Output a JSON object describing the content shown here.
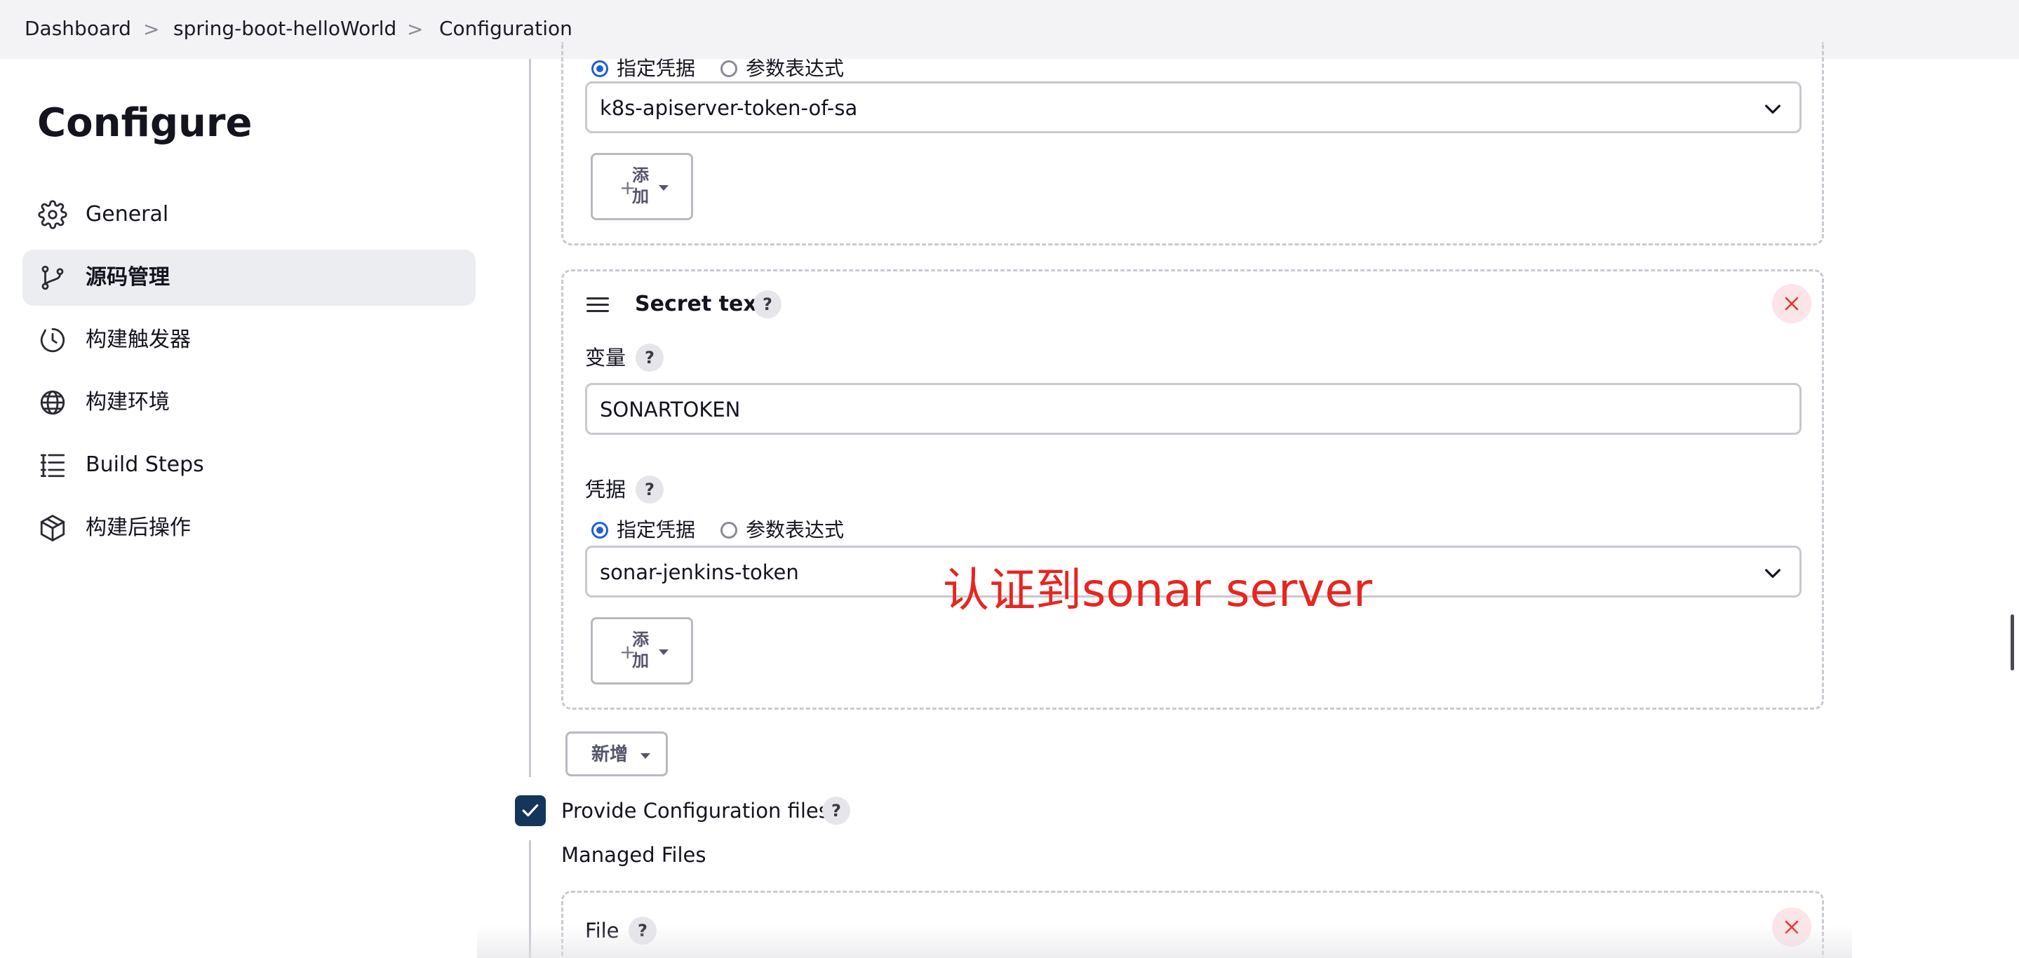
{
  "breadcrumb": {
    "items": [
      "Dashboard",
      "spring-boot-helloWorld",
      "Configuration"
    ],
    "separator": ">"
  },
  "sidebar": {
    "title": "Configure",
    "items": [
      {
        "label": "General",
        "icon": "gear-icon",
        "active": false
      },
      {
        "label": "源码管理",
        "icon": "branch-icon",
        "active": true
      },
      {
        "label": "构建触发器",
        "icon": "clock-icon",
        "active": false
      },
      {
        "label": "构建环境",
        "icon": "globe-icon",
        "active": false
      },
      {
        "label": "Build Steps",
        "icon": "list-icon",
        "active": false
      },
      {
        "label": "构建后操作",
        "icon": "package-icon",
        "active": false
      }
    ]
  },
  "binding1": {
    "radio_specific": "指定凭据",
    "radio_param": "参数表达式",
    "credential_value": "k8s-apiserver-token-of-sa",
    "add_button": "添加"
  },
  "binding2": {
    "title": "Secret text",
    "help": "?",
    "variable_label": "变量",
    "variable_value": "SONARTOKEN",
    "credential_label": "凭据",
    "radio_specific": "指定凭据",
    "radio_param": "参数表达式",
    "credential_value": "sonar-jenkins-token",
    "add_button": "添加"
  },
  "annotation": "认证到sonar server",
  "new_button": "新增",
  "provide_config": {
    "label": "Provide Configuration files",
    "checked": true,
    "help": "?"
  },
  "managed_files": {
    "label": "Managed Files",
    "file_title": "File",
    "help": "?"
  },
  "colors": {
    "accent": "#1f5fd6",
    "checkbox": "#14365a",
    "annotation": "#e8251f",
    "close": "#e5343b"
  }
}
